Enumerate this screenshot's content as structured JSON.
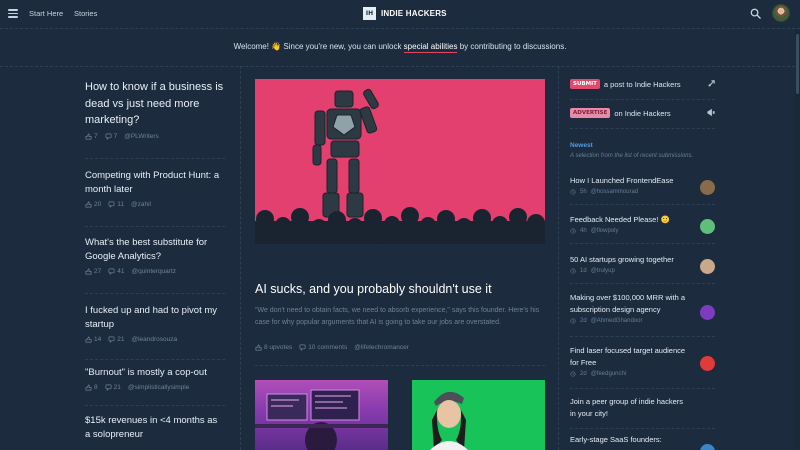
{
  "header": {
    "nav": [
      "Start Here",
      "Stories"
    ],
    "brand_logo": "IH",
    "brand_name": "INDIE HACKERS"
  },
  "welcome": {
    "prefix": "Welcome! ",
    "wave": "👋",
    "middle": " Since you're new, you can unlock ",
    "highlight": "special abilities",
    "suffix": " by contributing to discussions."
  },
  "left_posts": [
    {
      "title": "How to know if a business is dead vs just need more marketing?",
      "upvotes": "7",
      "comments": "7",
      "author": "@PLWriters"
    },
    {
      "title": "Competing with Product Hunt: a month later",
      "upvotes": "20",
      "comments": "11",
      "author": "@zahil"
    },
    {
      "title": "What's the best substitute for Google Analytics?",
      "upvotes": "27",
      "comments": "41",
      "author": "@quinterquartz"
    },
    {
      "title": "I fucked up and had to pivot my startup",
      "upvotes": "14",
      "comments": "21",
      "author": "@leandrosouza"
    },
    {
      "title": "\"Burnout\" is mostly a cop-out",
      "upvotes": "8",
      "comments": "21",
      "author": "@simplisticallysimple"
    },
    {
      "title": "$15k revenues in <4 months as a solopreneur",
      "upvotes": "",
      "comments": "",
      "author": ""
    }
  ],
  "feature": {
    "title": "AI sucks, and you probably shouldn't use it",
    "excerpt": "\"We don't need to obtain facts, we need to absorb experience,\" says this founder. Here's his case for why popular arguments that AI is going to take our jobs are overstated.",
    "upvotes": "8 upvotes",
    "comments": "10 comments",
    "author": "@lifetechromancer"
  },
  "sidebar": {
    "submit_badge": "SUBMIT",
    "submit_text": "a post to Indie Hackers",
    "advertise_badge": "ADVERTISE",
    "advertise_text": "on Indie Hackers",
    "newest_label": "Newest",
    "newest_sub": "A selection from the list of recent submissions.",
    "items": [
      {
        "title": "How I Launched FrontendEase",
        "time": "5h",
        "author": "@hossammourad",
        "avatar_color": "#8a6a4c"
      },
      {
        "title": "Feedback Needed Please! 🙂",
        "time": "4h",
        "author": "@flowpoly",
        "avatar_color": "#5fbf7a"
      },
      {
        "title": "50 AI startups growing together",
        "time": "1d",
        "author": "@trulyup",
        "avatar_color": "#c9a98a"
      },
      {
        "title": "Making over $100,000 MRR with a subscription design agency",
        "time": "2d",
        "author": "@AhmedGhandoor",
        "avatar_color": "#7d3cbf"
      },
      {
        "title": "Find laser focused target audience for Free",
        "time": "2d",
        "author": "@feedgunchi",
        "avatar_color": "#e03a3a"
      },
      {
        "title": "Join a peer group of indie hackers in your city!",
        "time": "",
        "author": "",
        "avatar_color": ""
      },
      {
        "title": "Early-stage SaaS founders:",
        "time": "",
        "author": "",
        "avatar_color": "#3a86c8"
      }
    ]
  },
  "colors": {
    "background": "#1c2b3e",
    "accent": "#e2495f",
    "feature_bg": "#e33f6f",
    "link_blue": "#4f9ee8"
  }
}
